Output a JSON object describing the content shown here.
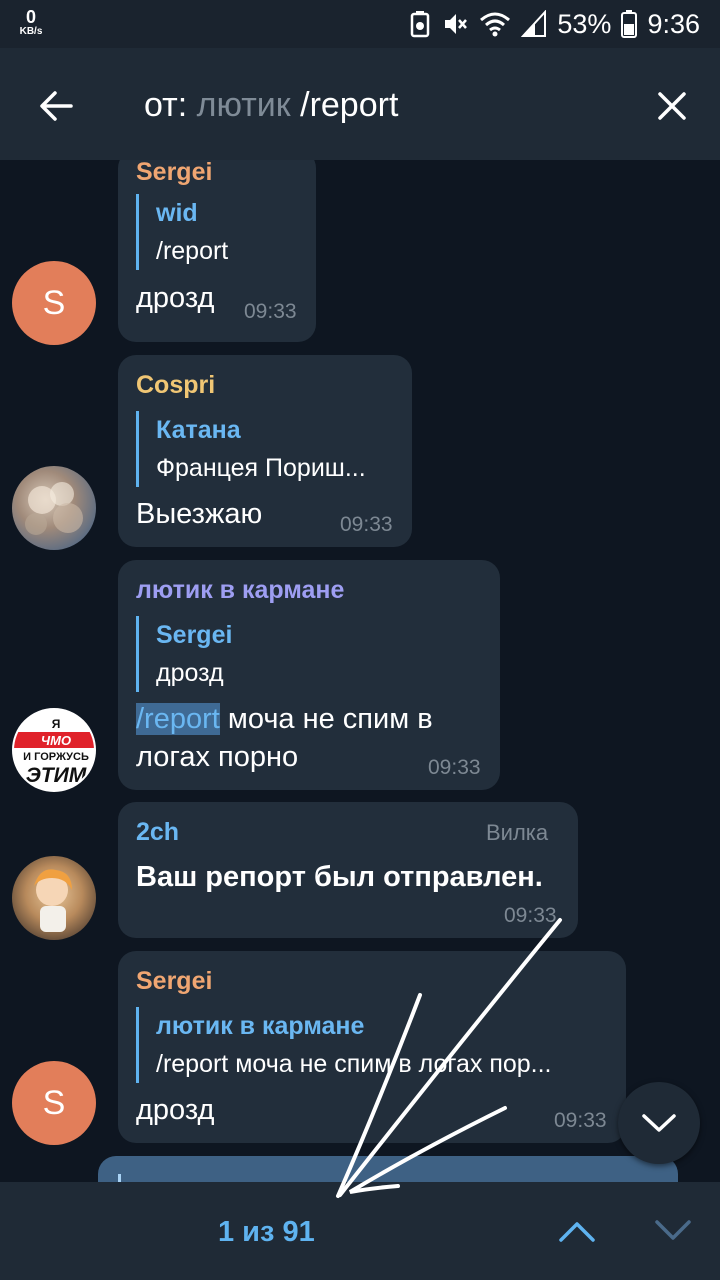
{
  "status_bar": {
    "net_speed_value": "0",
    "net_speed_unit": "KB/s",
    "battery_percent": "53%",
    "time": "9:36"
  },
  "header": {
    "query_prefix": "от:",
    "query_user": "лютик",
    "query_text": "/report",
    "icons": {
      "back": "back-arrow-icon",
      "close": "close-icon"
    }
  },
  "messages": [
    {
      "sender": "Sergei",
      "sender_color": "#f0a672",
      "avatar_letter": "S",
      "reply_name": "wid",
      "reply_text": "/report",
      "text": "дрозд",
      "time": "09:33"
    },
    {
      "sender": "Cospri",
      "sender_color": "#f0c674",
      "avatar_letter": "",
      "reply_name": "Катана",
      "reply_text": "Францея Пориш...",
      "text": "Выезжаю",
      "time": "09:33"
    },
    {
      "sender": "лютик в кармане",
      "sender_color": "#9e9ef2",
      "avatar_text": [
        "Я",
        "ЧМО",
        "И ГОРЖУСЬ",
        "ЭТИМ"
      ],
      "reply_name": "Sergei",
      "reply_text": "дрозд",
      "text_command": "/report",
      "text_rest": " моча не спим в",
      "text_line2": "логах порно",
      "time": "09:33"
    },
    {
      "sender": "2ch",
      "sender_color": "#6ab7f2",
      "badge": "Вилка",
      "text": "Ваш репорт был отправлен.",
      "time": "09:33"
    },
    {
      "sender": "Sergei",
      "sender_color": "#f0a672",
      "avatar_letter": "S",
      "reply_name": "лютик в кармане",
      "reply_text": "/report моча не спим в логах пор...",
      "text": "дрозд",
      "time": "09:33"
    }
  ],
  "bottom_bar": {
    "counter": "1 из 91",
    "icons": {
      "up": "chevron-up-icon",
      "down": "chevron-down-icon",
      "scroll_down": "scroll-down-icon"
    }
  },
  "colors": {
    "background": "#0e1621",
    "bar": "#1f2a36",
    "bubble": "#222e3b",
    "accent": "#5fb3f0"
  }
}
